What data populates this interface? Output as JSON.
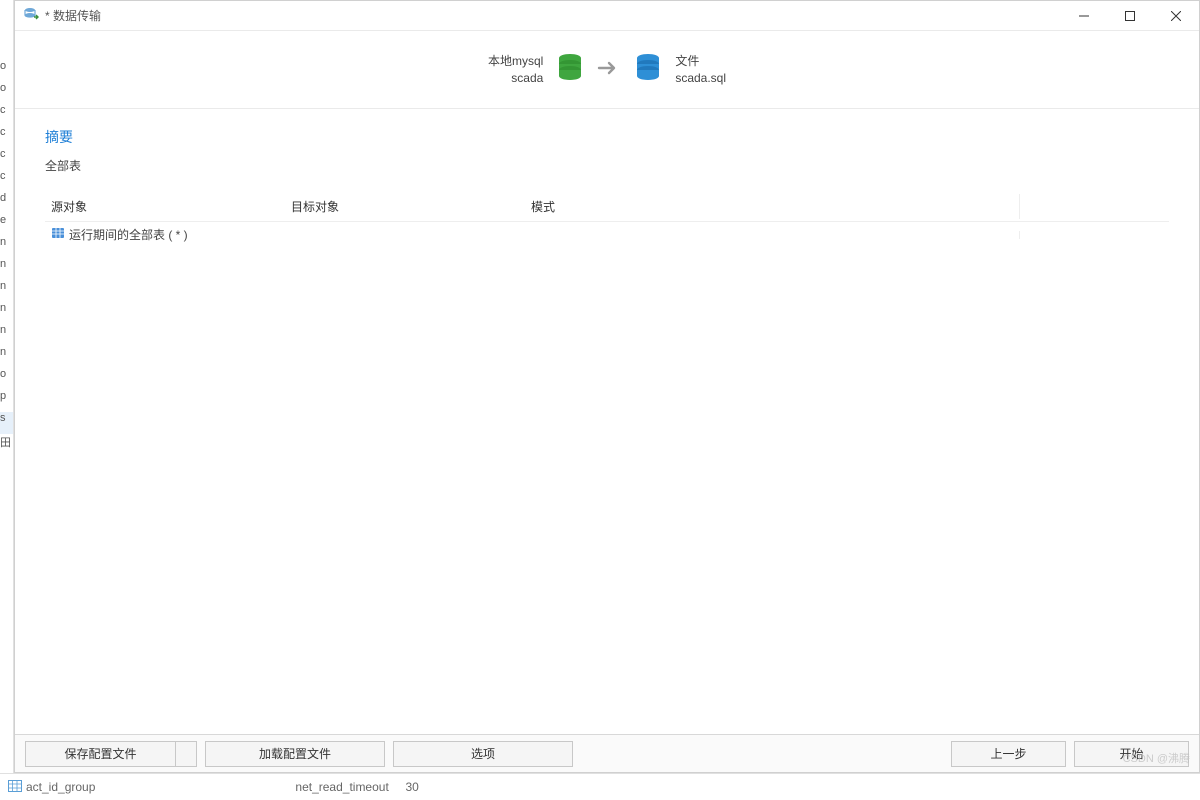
{
  "window": {
    "title": "* 数据传输"
  },
  "transfer": {
    "source_label_line1": "本地mysql",
    "source_label_line2": "scada",
    "target_label_line1": "文件",
    "target_label_line2": "scada.sql"
  },
  "summary": {
    "title": "摘要",
    "subtitle": "全部表"
  },
  "columns": {
    "source": "源对象",
    "target": "目标对象",
    "mode": "模式"
  },
  "rows": [
    {
      "source": "运行期间的全部表 ( * )",
      "target": "",
      "mode": ""
    }
  ],
  "buttons": {
    "save_config": "保存配置文件",
    "load_config": "加载配置文件",
    "options": "选项",
    "prev": "上一步",
    "start": "开始"
  },
  "footer": {
    "left": "act_id_group",
    "mid_key": "net_read_timeout",
    "mid_val": "30"
  },
  "watermark": "CSDN @沸腾"
}
